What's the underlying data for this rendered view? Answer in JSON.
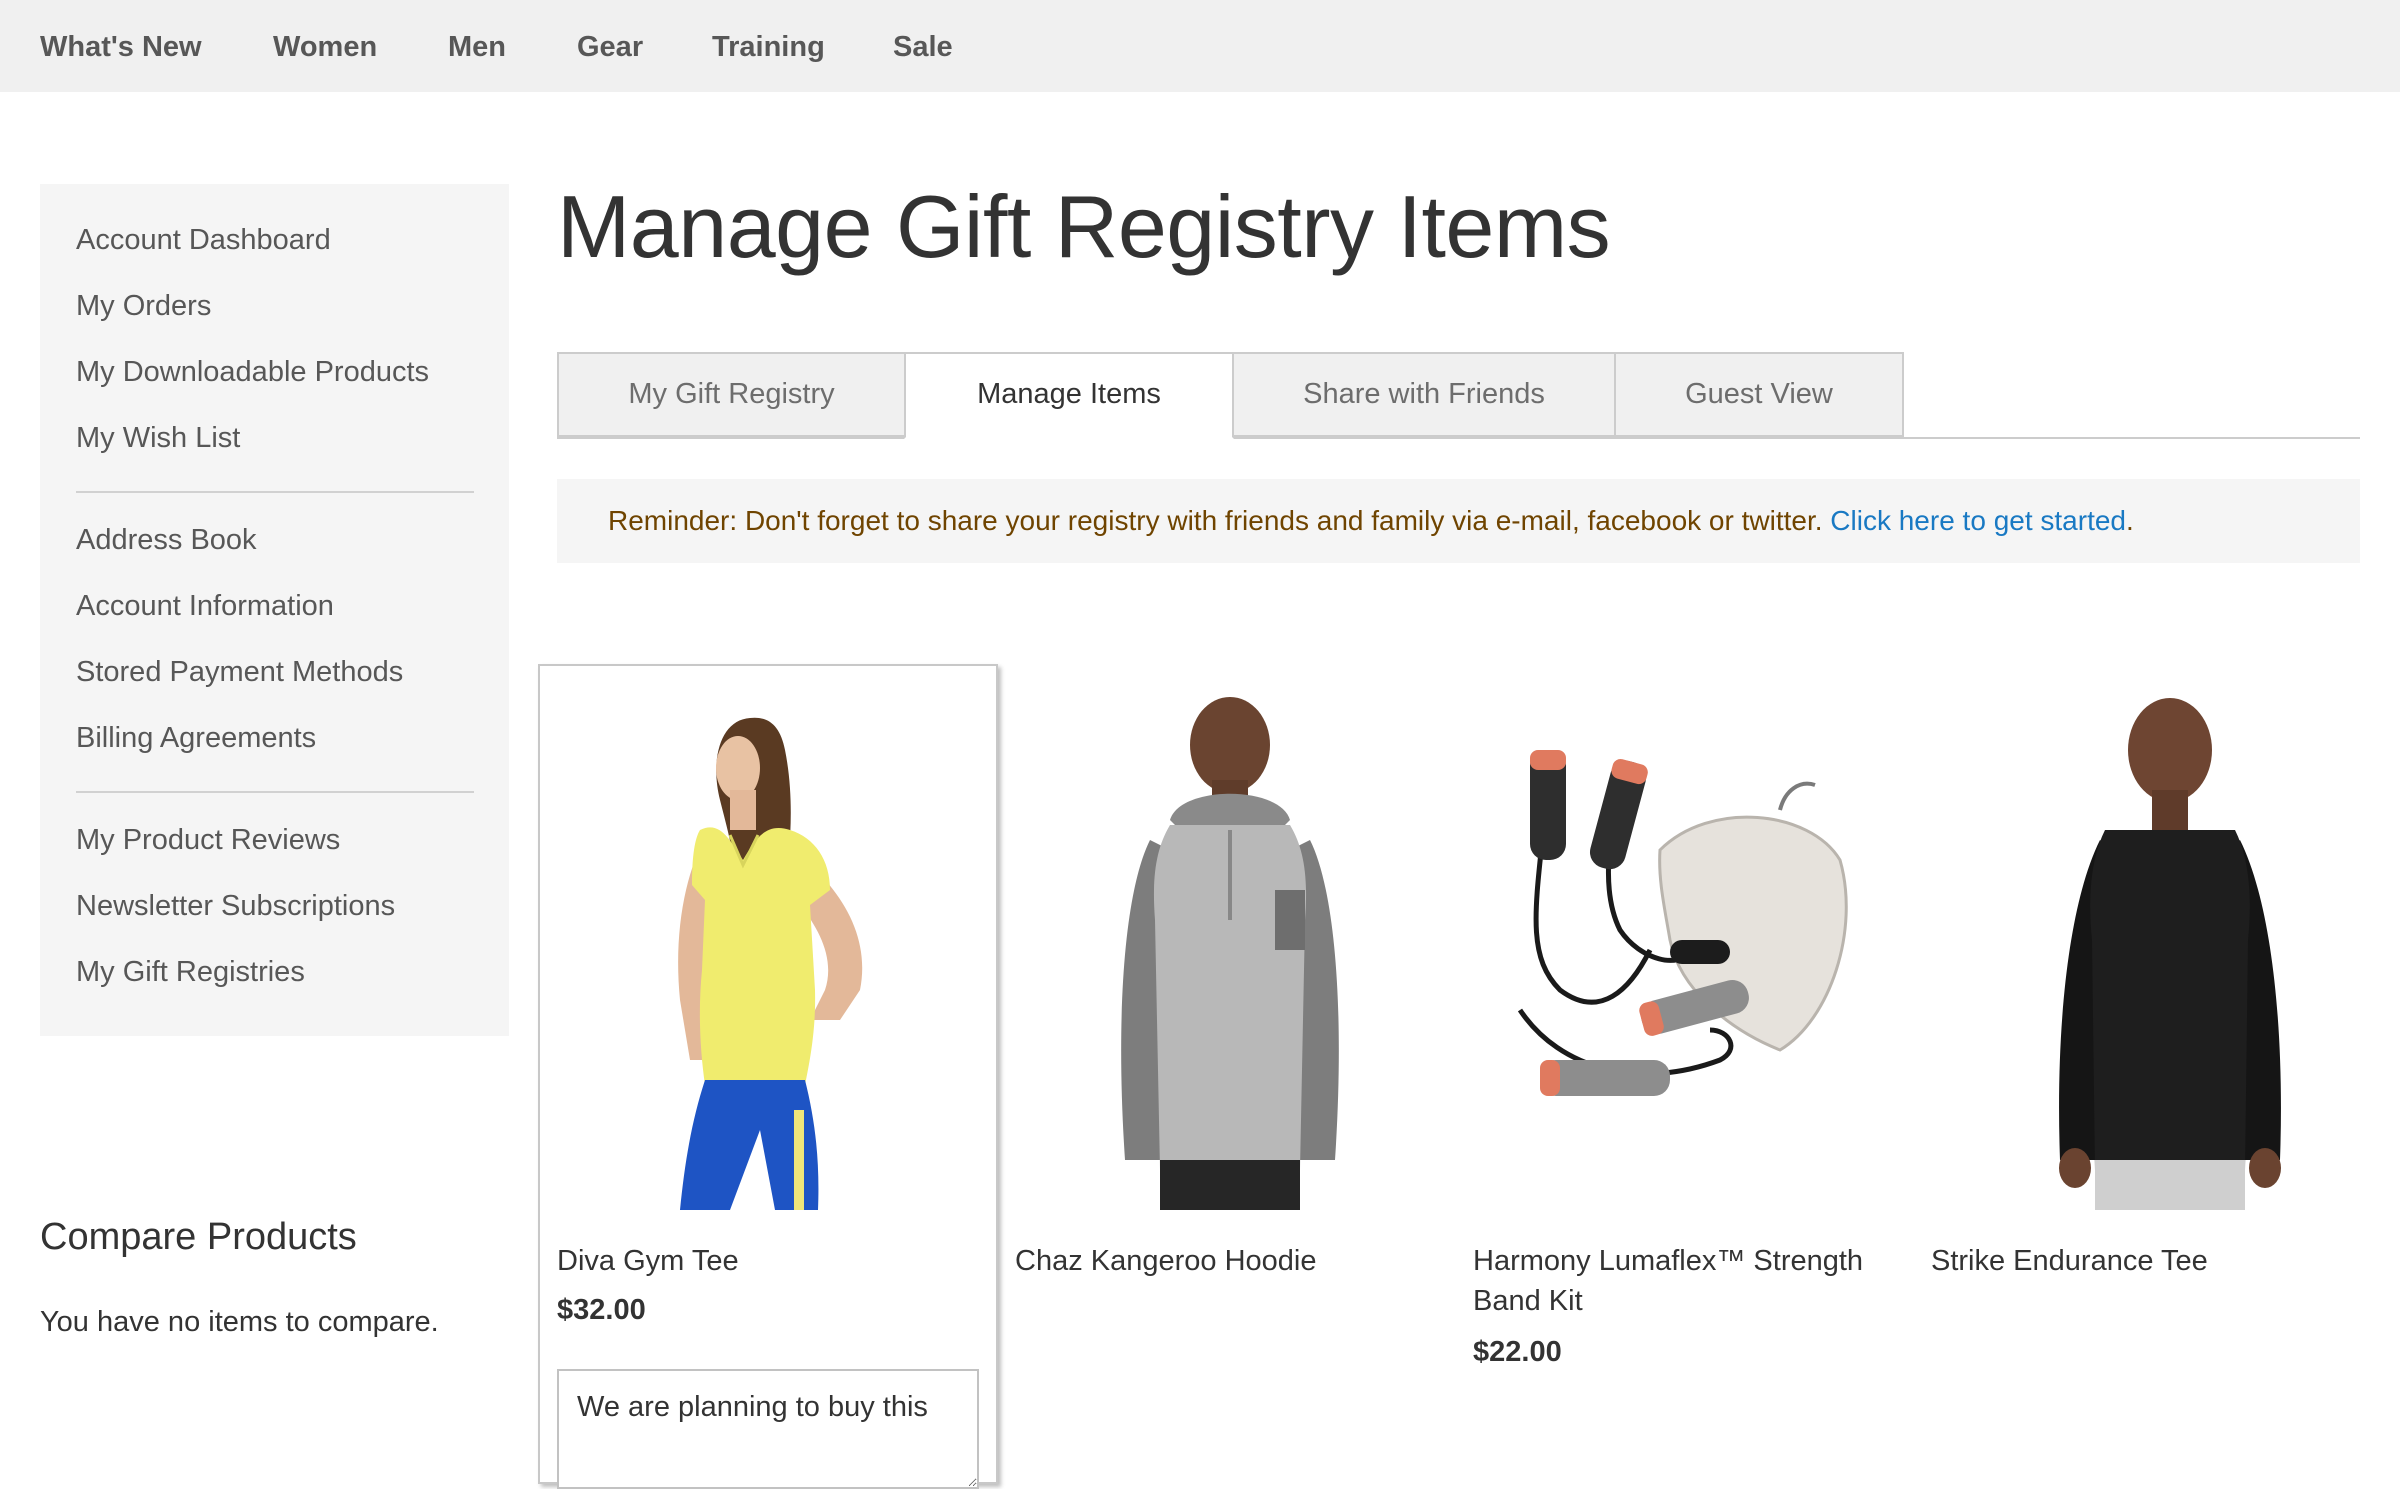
{
  "topnav": {
    "items": [
      "What's New",
      "Women",
      "Men",
      "Gear",
      "Training",
      "Sale"
    ]
  },
  "sidebar": {
    "group1": [
      "Account Dashboard",
      "My Orders",
      "My Downloadable Products",
      "My Wish List"
    ],
    "group2": [
      "Address Book",
      "Account Information",
      "Stored Payment Methods",
      "Billing Agreements"
    ],
    "group3": [
      "My Product Reviews",
      "Newsletter Subscriptions",
      "My Gift Registries"
    ]
  },
  "compare": {
    "title": "Compare Products",
    "empty": "You have no items to compare."
  },
  "main": {
    "title": "Manage Gift Registry Items",
    "tabs": [
      "My Gift Registry",
      "Manage Items",
      "Share with Friends",
      "Guest View"
    ],
    "active_tab": "Manage Items",
    "notice": {
      "text": "Reminder: Don't forget to share your registry with friends and family via e-mail, facebook or twitter. ",
      "link": "Click here to get started",
      "suffix": "."
    }
  },
  "products": [
    {
      "name": "Diva Gym Tee",
      "price": "$32.00",
      "comment": "We are planning to buy this",
      "image": "woman-yellow-tee"
    },
    {
      "name": "Chaz Kangeroo Hoodie",
      "price": "",
      "image": "man-gray-hoodie"
    },
    {
      "name": "Harmony Lumaflex™ Strength Band Kit",
      "price": "$22.00",
      "image": "resistance-bands-kit"
    },
    {
      "name": "Strike Endurance Tee",
      "price": "",
      "image": "man-black-longsleeve"
    }
  ],
  "colors": {
    "nav_bg": "#f0f0f0",
    "sidebar_bg": "#f5f5f5",
    "link": "#1979c3",
    "notice_text": "#6f4400"
  }
}
